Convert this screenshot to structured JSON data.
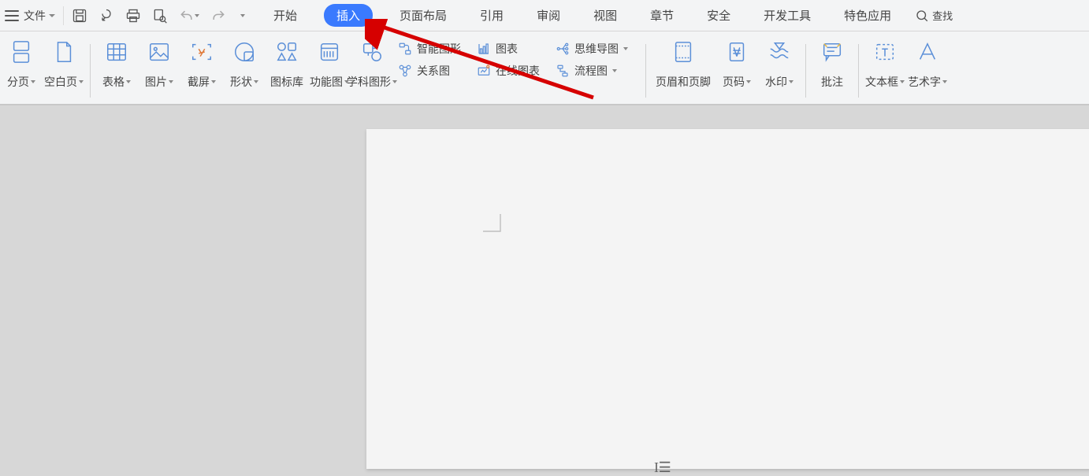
{
  "topbar": {
    "file_label": "文件",
    "search_label": "查找"
  },
  "tabs": [
    {
      "label": "开始",
      "active": false
    },
    {
      "label": "插入",
      "active": true
    },
    {
      "label": "页面布局",
      "active": false
    },
    {
      "label": "引用",
      "active": false
    },
    {
      "label": "审阅",
      "active": false
    },
    {
      "label": "视图",
      "active": false
    },
    {
      "label": "章节",
      "active": false
    },
    {
      "label": "安全",
      "active": false
    },
    {
      "label": "开发工具",
      "active": false
    },
    {
      "label": "特色应用",
      "active": false
    }
  ],
  "ribbon": {
    "pagebreak": "分页",
    "blankpage": "空白页",
    "table": "表格",
    "picture": "图片",
    "screenshot": "截屏",
    "shape": "形状",
    "iconlib": "图标库",
    "fnchart": "功能图",
    "subjshape": "学科图形",
    "smart": "智能图形",
    "chart": "图表",
    "relation": "关系图",
    "onlinechart": "在线图表",
    "mindmap": "思维导图",
    "flowchart": "流程图",
    "headerfooter": "页眉和页脚",
    "pagenum": "页码",
    "watermark": "水印",
    "comment": "批注",
    "textbox": "文本框",
    "wordart": "艺术字"
  },
  "colors": {
    "icon": "#5b8fd8",
    "accent": "#3a7afe",
    "arrow": "#d60000"
  }
}
